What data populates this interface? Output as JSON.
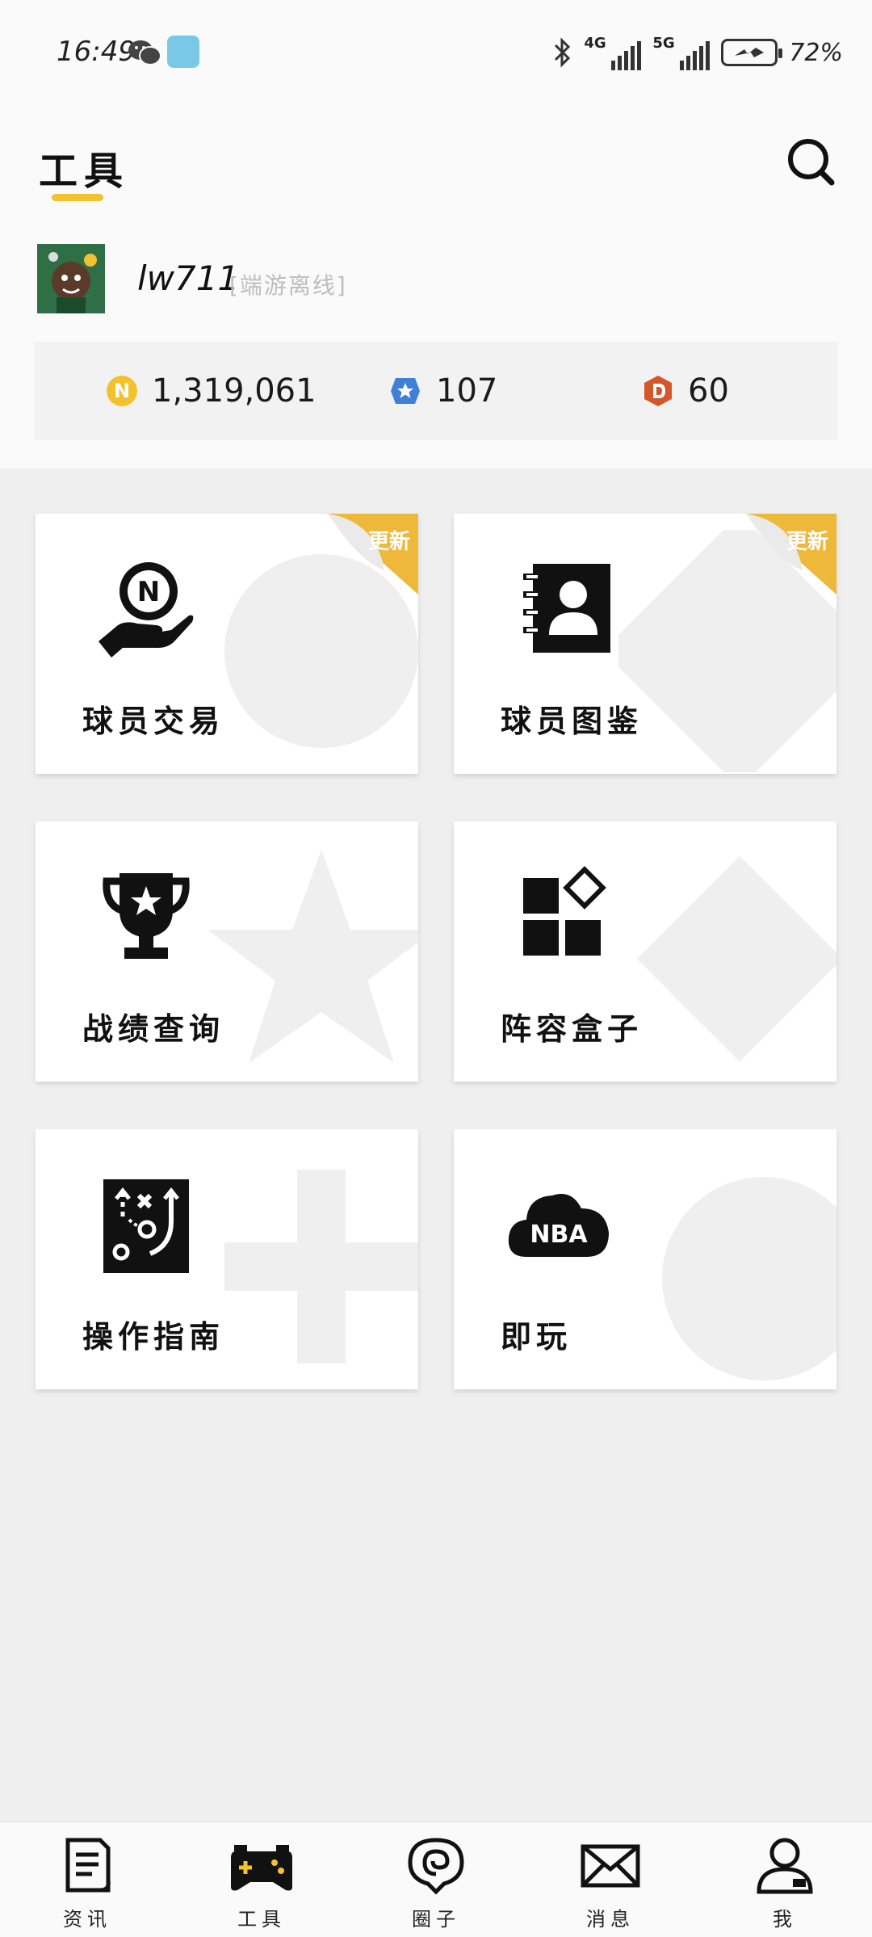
{
  "status_bar": {
    "time": "16:49",
    "network_1": "4G",
    "network_2": "5G",
    "battery_percent": "72%"
  },
  "header": {
    "title": "工具",
    "accent_color": "#f2c230"
  },
  "user": {
    "name": "lw711",
    "status": "[端游离线]"
  },
  "currencies": {
    "coins": "1,319,061",
    "stars": "107",
    "d_points": "60"
  },
  "tools": [
    {
      "label": "球员交易",
      "badge": "更新",
      "icon": "n-coin-hand-icon"
    },
    {
      "label": "球员图鉴",
      "badge": "更新",
      "icon": "player-book-icon"
    },
    {
      "label": "战绩查询",
      "icon": "trophy-icon"
    },
    {
      "label": "阵容盒子",
      "icon": "blocks-icon"
    },
    {
      "label": "操作指南",
      "icon": "tactics-board-icon"
    },
    {
      "label": "即玩",
      "icon": "nba-cloud-icon",
      "icon_text": "NBA"
    }
  ],
  "bottom_nav": [
    {
      "label": "资讯",
      "icon": "document-icon"
    },
    {
      "label": "工具",
      "icon": "gamepad-icon",
      "active": true
    },
    {
      "label": "圈子",
      "icon": "circle-spiral-icon"
    },
    {
      "label": "消息",
      "icon": "mail-icon"
    },
    {
      "label": "我",
      "icon": "user-icon"
    }
  ]
}
